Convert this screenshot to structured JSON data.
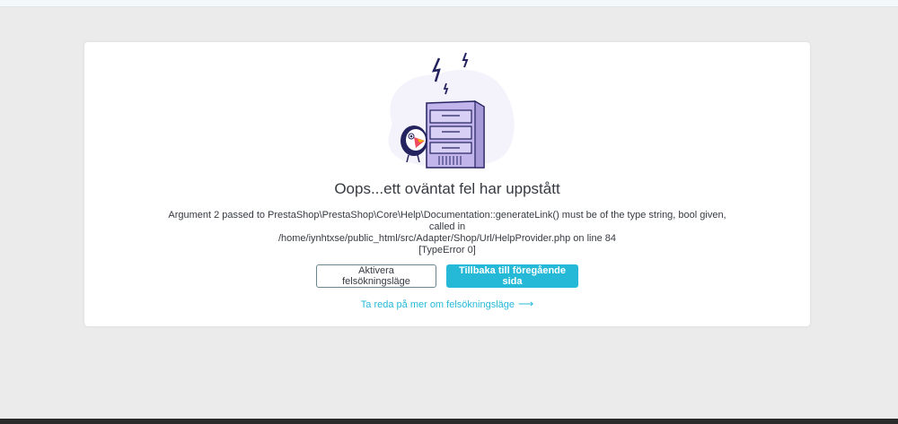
{
  "error": {
    "title": "Oops...ett oväntat fel har uppstått",
    "message_line1": "Argument 2 passed to PrestaShop\\PrestaShop\\Core\\Help\\Documentation::generateLink() must be of the type string, bool given, called in",
    "message_line2": "/home/iynhtxse/public_html/src/Adapter/Shop/Url/HelpProvider.php on line 84",
    "message_line3": "[TypeError 0]"
  },
  "actions": {
    "debug_label": "Aktivera felsökningsläge",
    "back_label": "Tillbaka till föregående sida",
    "learn_more_label": "Ta reda på mer om felsökningsläge",
    "learn_more_arrow": "⟶"
  },
  "colors": {
    "accent": "#25b9d7",
    "illustration": "#c1b5ec",
    "illustration_bg": "#f4f3fb"
  },
  "icons": {
    "illustration": "server-puffin-illustration",
    "arrow": "arrow-right-icon"
  }
}
